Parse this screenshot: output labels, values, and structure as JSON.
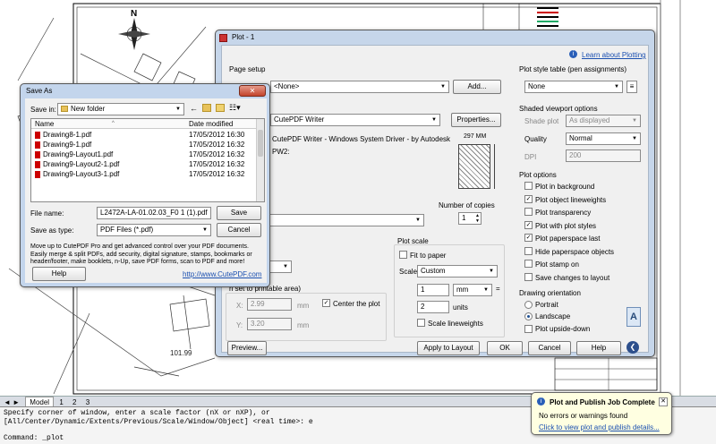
{
  "cad": {
    "annotation": "101.99",
    "tabs": [
      "Model",
      "1",
      "2",
      "3"
    ],
    "command_lines": [
      "Specify corner of window, enter a scale factor (nX or nXP), or",
      "[All/Center/Dynamic/Extents/Previous/Scale/Window/Object] <real time>: e",
      "Command:  _plot"
    ]
  },
  "plot": {
    "title": "Plot - 1",
    "learn_link": "Learn about Plotting",
    "page_setup_label": "Page setup",
    "page_setup_value": "<None>",
    "add_button": "Add...",
    "printer_value": "CutePDF Writer",
    "properties_button": "Properties...",
    "printer_desc": "CutePDF Writer - Windows System Driver - by Autodesk",
    "port_label": "PW2:",
    "paper_width": "297 MM",
    "copies_label": "Number of copies",
    "copies_value": "1",
    "plot_scale_label": "Plot scale",
    "fit_to_paper": "Fit to paper",
    "scale_label": "Scale:",
    "scale_value": "Custom",
    "scale_num": "1",
    "scale_unit": "mm",
    "scale_den": "2",
    "scale_den_unit": "units",
    "scale_lineweights": "Scale lineweights",
    "offset_label": "n set to printable area)",
    "x_label": "X:",
    "x_value": "2.99",
    "y_label": "Y:",
    "y_value": "3.20",
    "mm": "mm",
    "center_plot": "Center the plot",
    "preview_button": "Preview...",
    "apply_button": "Apply to Layout",
    "ok_button": "OK",
    "cancel_button": "Cancel",
    "help_button": "Help",
    "style_table_label": "Plot style table (pen assignments)",
    "style_table_value": "None",
    "shaded_label": "Shaded viewport options",
    "shade_plot_label": "Shade plot",
    "shade_plot_value": "As displayed",
    "quality_label": "Quality",
    "quality_value": "Normal",
    "dpi_label": "DPI",
    "dpi_value": "200",
    "options_label": "Plot options",
    "options": [
      {
        "label": "Plot in background",
        "checked": false
      },
      {
        "label": "Plot object lineweights",
        "checked": true
      },
      {
        "label": "Plot transparency",
        "checked": false
      },
      {
        "label": "Plot with plot styles",
        "checked": true
      },
      {
        "label": "Plot paperspace last",
        "checked": true
      },
      {
        "label": "Hide paperspace objects",
        "checked": false
      },
      {
        "label": "Plot stamp on",
        "checked": false
      },
      {
        "label": "Save changes to layout",
        "checked": false
      }
    ],
    "orientation_label": "Drawing orientation",
    "portrait": "Portrait",
    "landscape": "Landscape",
    "upside_down": "Plot upside-down"
  },
  "saveas": {
    "title": "Save As",
    "save_in_label": "Save in:",
    "save_in_value": "New folder",
    "col_name": "Name",
    "col_date": "Date modified",
    "files": [
      {
        "name": "Drawing8-1.pdf",
        "date": "17/05/2012 16:30"
      },
      {
        "name": "Drawing9-1.pdf",
        "date": "17/05/2012 16:32"
      },
      {
        "name": "Drawing9-Layout1.pdf",
        "date": "17/05/2012 16:32"
      },
      {
        "name": "Drawing9-Layout2-1.pdf",
        "date": "17/05/2012 16:32"
      },
      {
        "name": "Drawing9-Layout3-1.pdf",
        "date": "17/05/2012 16:32"
      }
    ],
    "filename_label": "File name:",
    "filename_value": "L2472A-LA-01.02.03_F0 1 (1).pdf",
    "savetype_label": "Save as type:",
    "savetype_value": "PDF Files (*.pdf)",
    "save_button": "Save",
    "cancel_button": "Cancel",
    "promo": "Move up to CutePDF Pro and get advanced control over your PDF documents. Easily merge & split PDFs, add security, digital signature, stamps, bookmarks or header/footer, make booklets, n-Up, save PDF forms, scan to PDF and more!",
    "help_button": "Help",
    "link": "http://www.CutePDF.com"
  },
  "toast": {
    "title": "Plot and Publish Job Complete",
    "message": "No errors or warnings found",
    "link": "Click to view plot and publish details..."
  }
}
